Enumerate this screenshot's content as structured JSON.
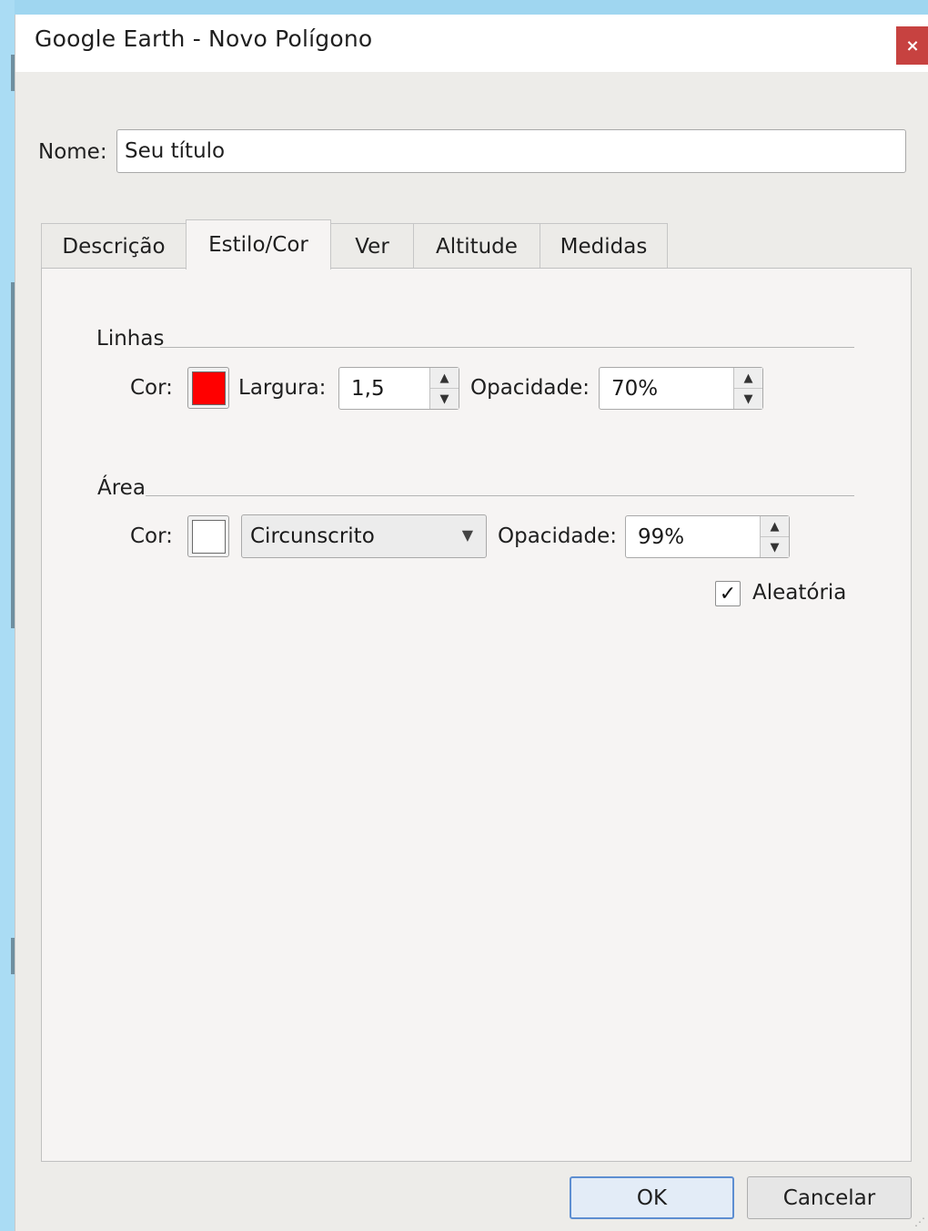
{
  "window": {
    "title": "Google Earth - Novo Polígono",
    "close_label": "×"
  },
  "name_field": {
    "label": "Nome:",
    "value": "Seu título"
  },
  "tabs": [
    {
      "label": "Descrição",
      "active": false
    },
    {
      "label": "Estilo/Cor",
      "active": true
    },
    {
      "label": "Ver",
      "active": false
    },
    {
      "label": "Altitude",
      "active": false
    },
    {
      "label": "Medidas",
      "active": false
    }
  ],
  "lines_group": {
    "title": "Linhas",
    "color_label": "Cor:",
    "color": "#ff0000",
    "width_label": "Largura:",
    "width_value": "1,5",
    "opacity_label": "Opacidade:",
    "opacity_value": "70%"
  },
  "area_group": {
    "title": "Área",
    "color_label": "Cor:",
    "color": "#ffffff",
    "fill_mode": "Circunscrito",
    "opacity_label": "Opacidade:",
    "opacity_value": "99%",
    "random_label": "Aleatória",
    "random_checked": true,
    "check_mark": "✓"
  },
  "buttons": {
    "ok": "OK",
    "cancel": "Cancelar"
  },
  "icons": {
    "spin_up": "▲",
    "spin_down": "▼",
    "caret": "▼",
    "resize": "⋰"
  }
}
